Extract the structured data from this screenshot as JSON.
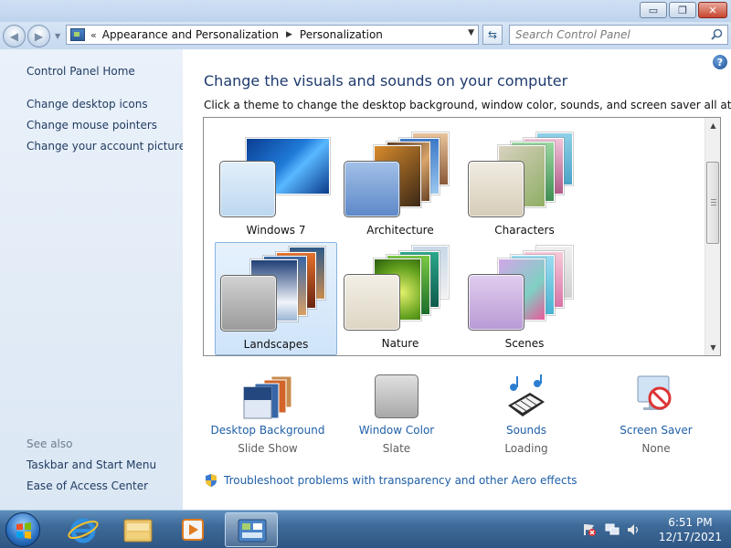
{
  "window": {
    "minimize_glyph": "▭",
    "maximize_glyph": "❐",
    "close_glyph": "✕"
  },
  "addressbar": {
    "overflow": "«",
    "crumbs": [
      "Appearance and Personalization",
      "Personalization"
    ],
    "search_placeholder": "Search Control Panel"
  },
  "sidebar": {
    "home": "Control Panel Home",
    "links": [
      "Change desktop icons",
      "Change mouse pointers",
      "Change your account picture"
    ],
    "see_also_label": "See also",
    "see_also": [
      "Taskbar and Start Menu",
      "Ease of Access Center"
    ]
  },
  "main": {
    "heading": "Change the visuals and sounds on your computer",
    "subheading": "Click a theme to change the desktop background, window color, sounds, and screen saver all at once.",
    "themes": [
      {
        "name": "Windows 7",
        "selected": false
      },
      {
        "name": "Architecture",
        "selected": false
      },
      {
        "name": "Characters",
        "selected": false
      },
      {
        "name": "Landscapes",
        "selected": true
      },
      {
        "name": "Nature",
        "selected": false
      },
      {
        "name": "Scenes",
        "selected": false
      }
    ],
    "settings": [
      {
        "label": "Desktop Background",
        "value": "Slide Show",
        "icon": "desktop-background-icon"
      },
      {
        "label": "Window Color",
        "value": "Slate",
        "icon": "window-color-icon"
      },
      {
        "label": "Sounds",
        "value": "Loading",
        "icon": "sounds-icon"
      },
      {
        "label": "Screen Saver",
        "value": "None",
        "icon": "screen-saver-icon"
      }
    ],
    "troubleshoot": "Troubleshoot problems with transparency and other Aero effects"
  },
  "taskbar": {
    "time": "6:51 PM",
    "date": "12/17/2021"
  },
  "colors": {
    "link": "#1f5fa8",
    "heading": "#1e3a6e",
    "selected_theme_bg": "#d7e9fb"
  }
}
